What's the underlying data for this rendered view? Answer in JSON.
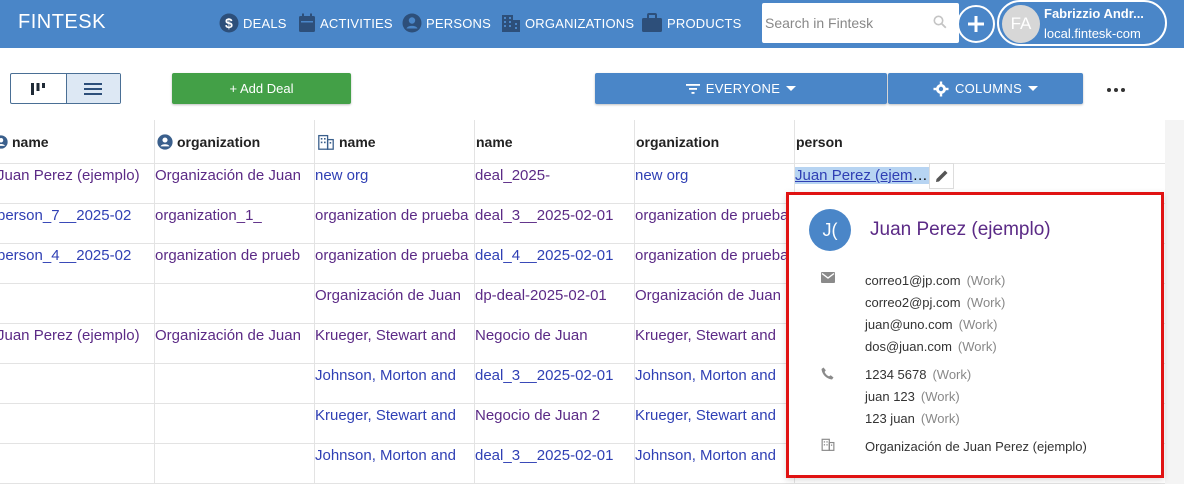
{
  "app": {
    "name": "FINTESK"
  },
  "nav": [
    {
      "label": "DEALS",
      "icon": "dollar-icon"
    },
    {
      "label": "ACTIVITIES",
      "icon": "calendar-icon"
    },
    {
      "label": "PERSONS",
      "icon": "person-icon"
    },
    {
      "label": "ORGANIZATIONS",
      "icon": "building-icon"
    },
    {
      "label": "PRODUCTS",
      "icon": "briefcase-icon"
    }
  ],
  "search": {
    "placeholder": "Search in Fintesk",
    "value": ""
  },
  "user": {
    "initials": "FA",
    "name": "Fabrizzio Andr...",
    "host": "local.fintesk-com"
  },
  "toolbar": {
    "add_deal": "+ Add Deal",
    "filter": "EVERYONE",
    "columns": "COLUMNS"
  },
  "colors": {
    "topbar": "#4a86c8",
    "add_deal": "#43a047",
    "link_purple": "#5b2a86",
    "link_blue": "#2f3fb4",
    "highlight": "#e01212"
  },
  "table": {
    "headers": [
      {
        "label": "name",
        "icon": "person-icon"
      },
      {
        "label": "organization",
        "icon": "person-icon"
      },
      {
        "label": "name",
        "icon": "building-icon"
      },
      {
        "label": "name",
        "icon": ""
      },
      {
        "label": "organization",
        "icon": ""
      },
      {
        "label": "person",
        "icon": ""
      }
    ],
    "rows": [
      [
        "Juan Perez (ejemplo)",
        "Organización de Juan",
        "new org",
        "deal_2025-",
        "new org",
        "Juan Perez (ejemplo)"
      ],
      [
        "person_7__2025-02",
        "organization_1_",
        "organization de prueba",
        "deal_3__2025-02-01",
        "organization de prueba",
        ""
      ],
      [
        "person_4__2025-02",
        "organization de prueb",
        "organization de prueba",
        "deal_4__2025-02-01",
        "organization de prueba",
        ""
      ],
      [
        "",
        "",
        "Organización de Juan",
        "dp-deal-2025-02-01",
        "Organización de Juan",
        ""
      ],
      [
        "Juan Perez (ejemplo)",
        "Organización de Juan",
        "Krueger, Stewart and",
        "Negocio de Juan",
        "Krueger, Stewart and",
        ""
      ],
      [
        "",
        "",
        "Johnson, Morton and",
        "deal_3__2025-02-01",
        "Johnson, Morton and",
        ""
      ],
      [
        "",
        "",
        "Krueger, Stewart and",
        "Negocio de Juan 2",
        "Krueger, Stewart and",
        ""
      ],
      [
        "",
        "",
        "Johnson, Morton and",
        "deal_3__2025-02-01",
        "Johnson, Morton and",
        ""
      ]
    ]
  },
  "popup": {
    "initials": "J(",
    "name": "Juan Perez (ejemplo)",
    "emails": [
      {
        "value": "correo1@jp.com",
        "label": "(Work)"
      },
      {
        "value": "correo2@pj.com",
        "label": "(Work)"
      },
      {
        "value": "juan@uno.com",
        "label": "(Work)"
      },
      {
        "value": "dos@juan.com",
        "label": "(Work)"
      }
    ],
    "phones": [
      {
        "value": "1234 5678",
        "label": "(Work)"
      },
      {
        "value": "juan 123",
        "label": "(Work)"
      },
      {
        "value": "123 juan",
        "label": "(Work)"
      }
    ],
    "organization": "Organización de Juan Perez (ejemplo)"
  }
}
